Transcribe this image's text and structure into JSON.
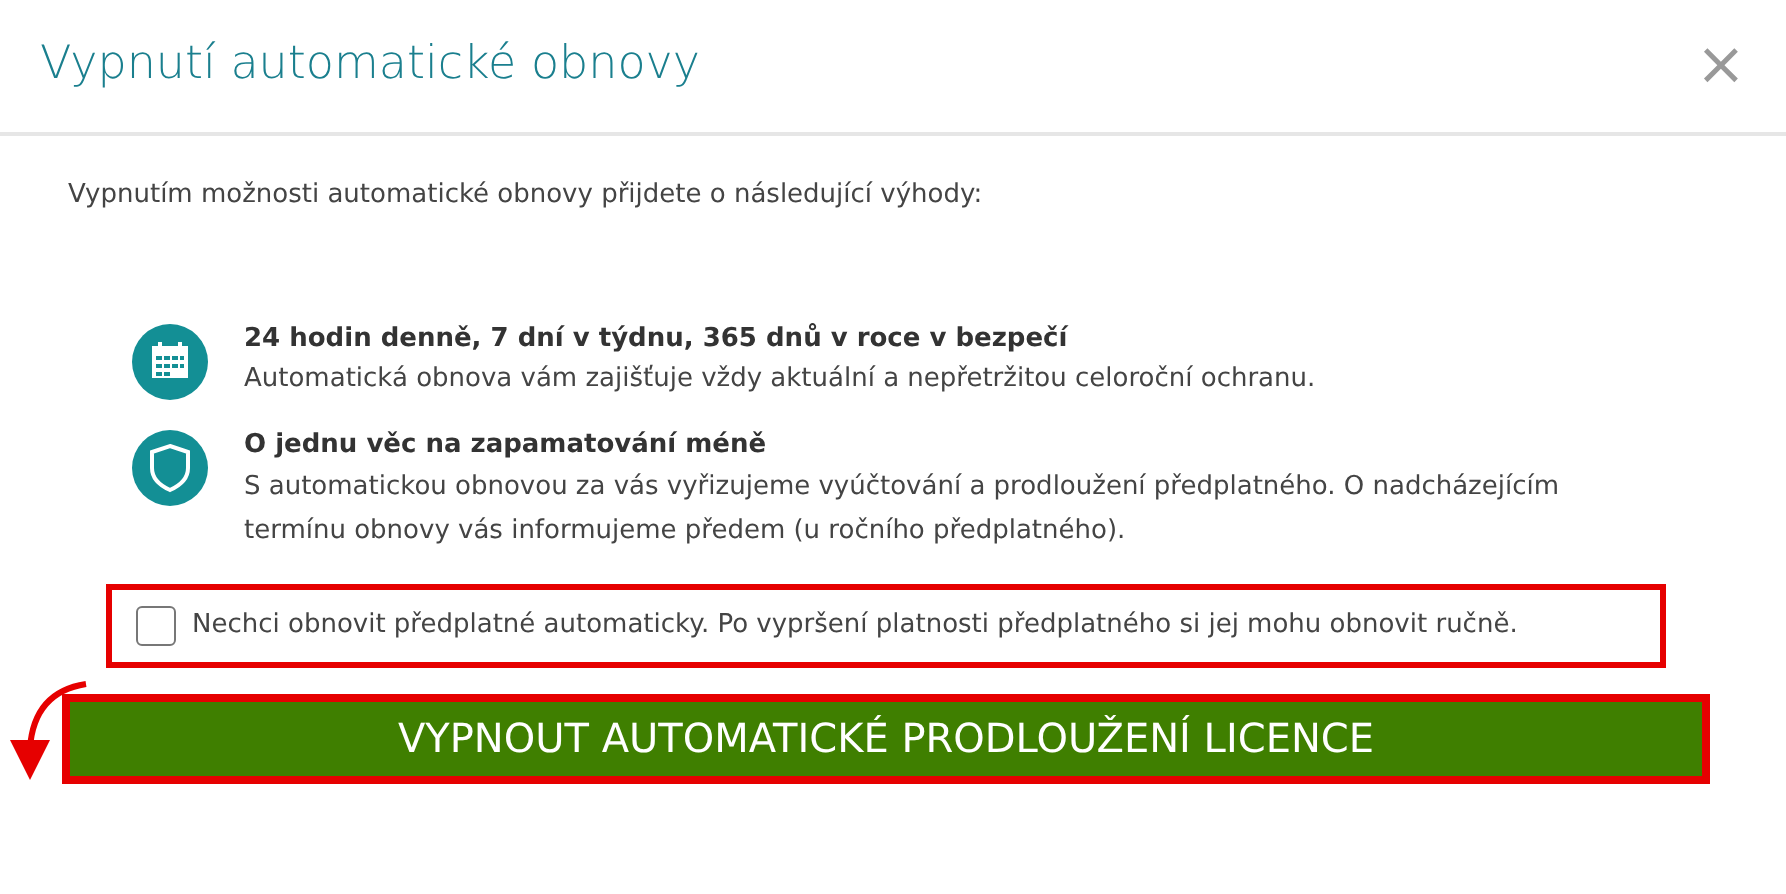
{
  "dialog": {
    "title": "Vypnutí automatické obnovy",
    "close": "×"
  },
  "intro": "Vypnutím možnosti automatické obnovy přijdete o následující výhody:",
  "benefits": [
    {
      "kind": "calendar",
      "title": "24 hodin denně, 7 dní v týdnu, 365 dnů v roce v bezpečí",
      "text": "Automatická obnova vám zajišťuje vždy aktuální a nepřetržitou celoroční ochranu."
    },
    {
      "kind": "shield",
      "title": "O jednu věc na zapamatování méně",
      "text": "S automatickou obnovou za vás vyřizujeme vyúčtování a prodloužení předplatného. O nadcházejícím termínu obnovy vás informujeme předem (u ročního předplatného)."
    }
  ],
  "confirm": {
    "label": "Nechci obnovit předplatné automaticky. Po vypršení platnosti předplatného si jej mohu obnovit ručně.",
    "checked": false
  },
  "button": "VYPNOUT AUTOMATICKÉ PRODLOUŽENÍ LICENCE"
}
